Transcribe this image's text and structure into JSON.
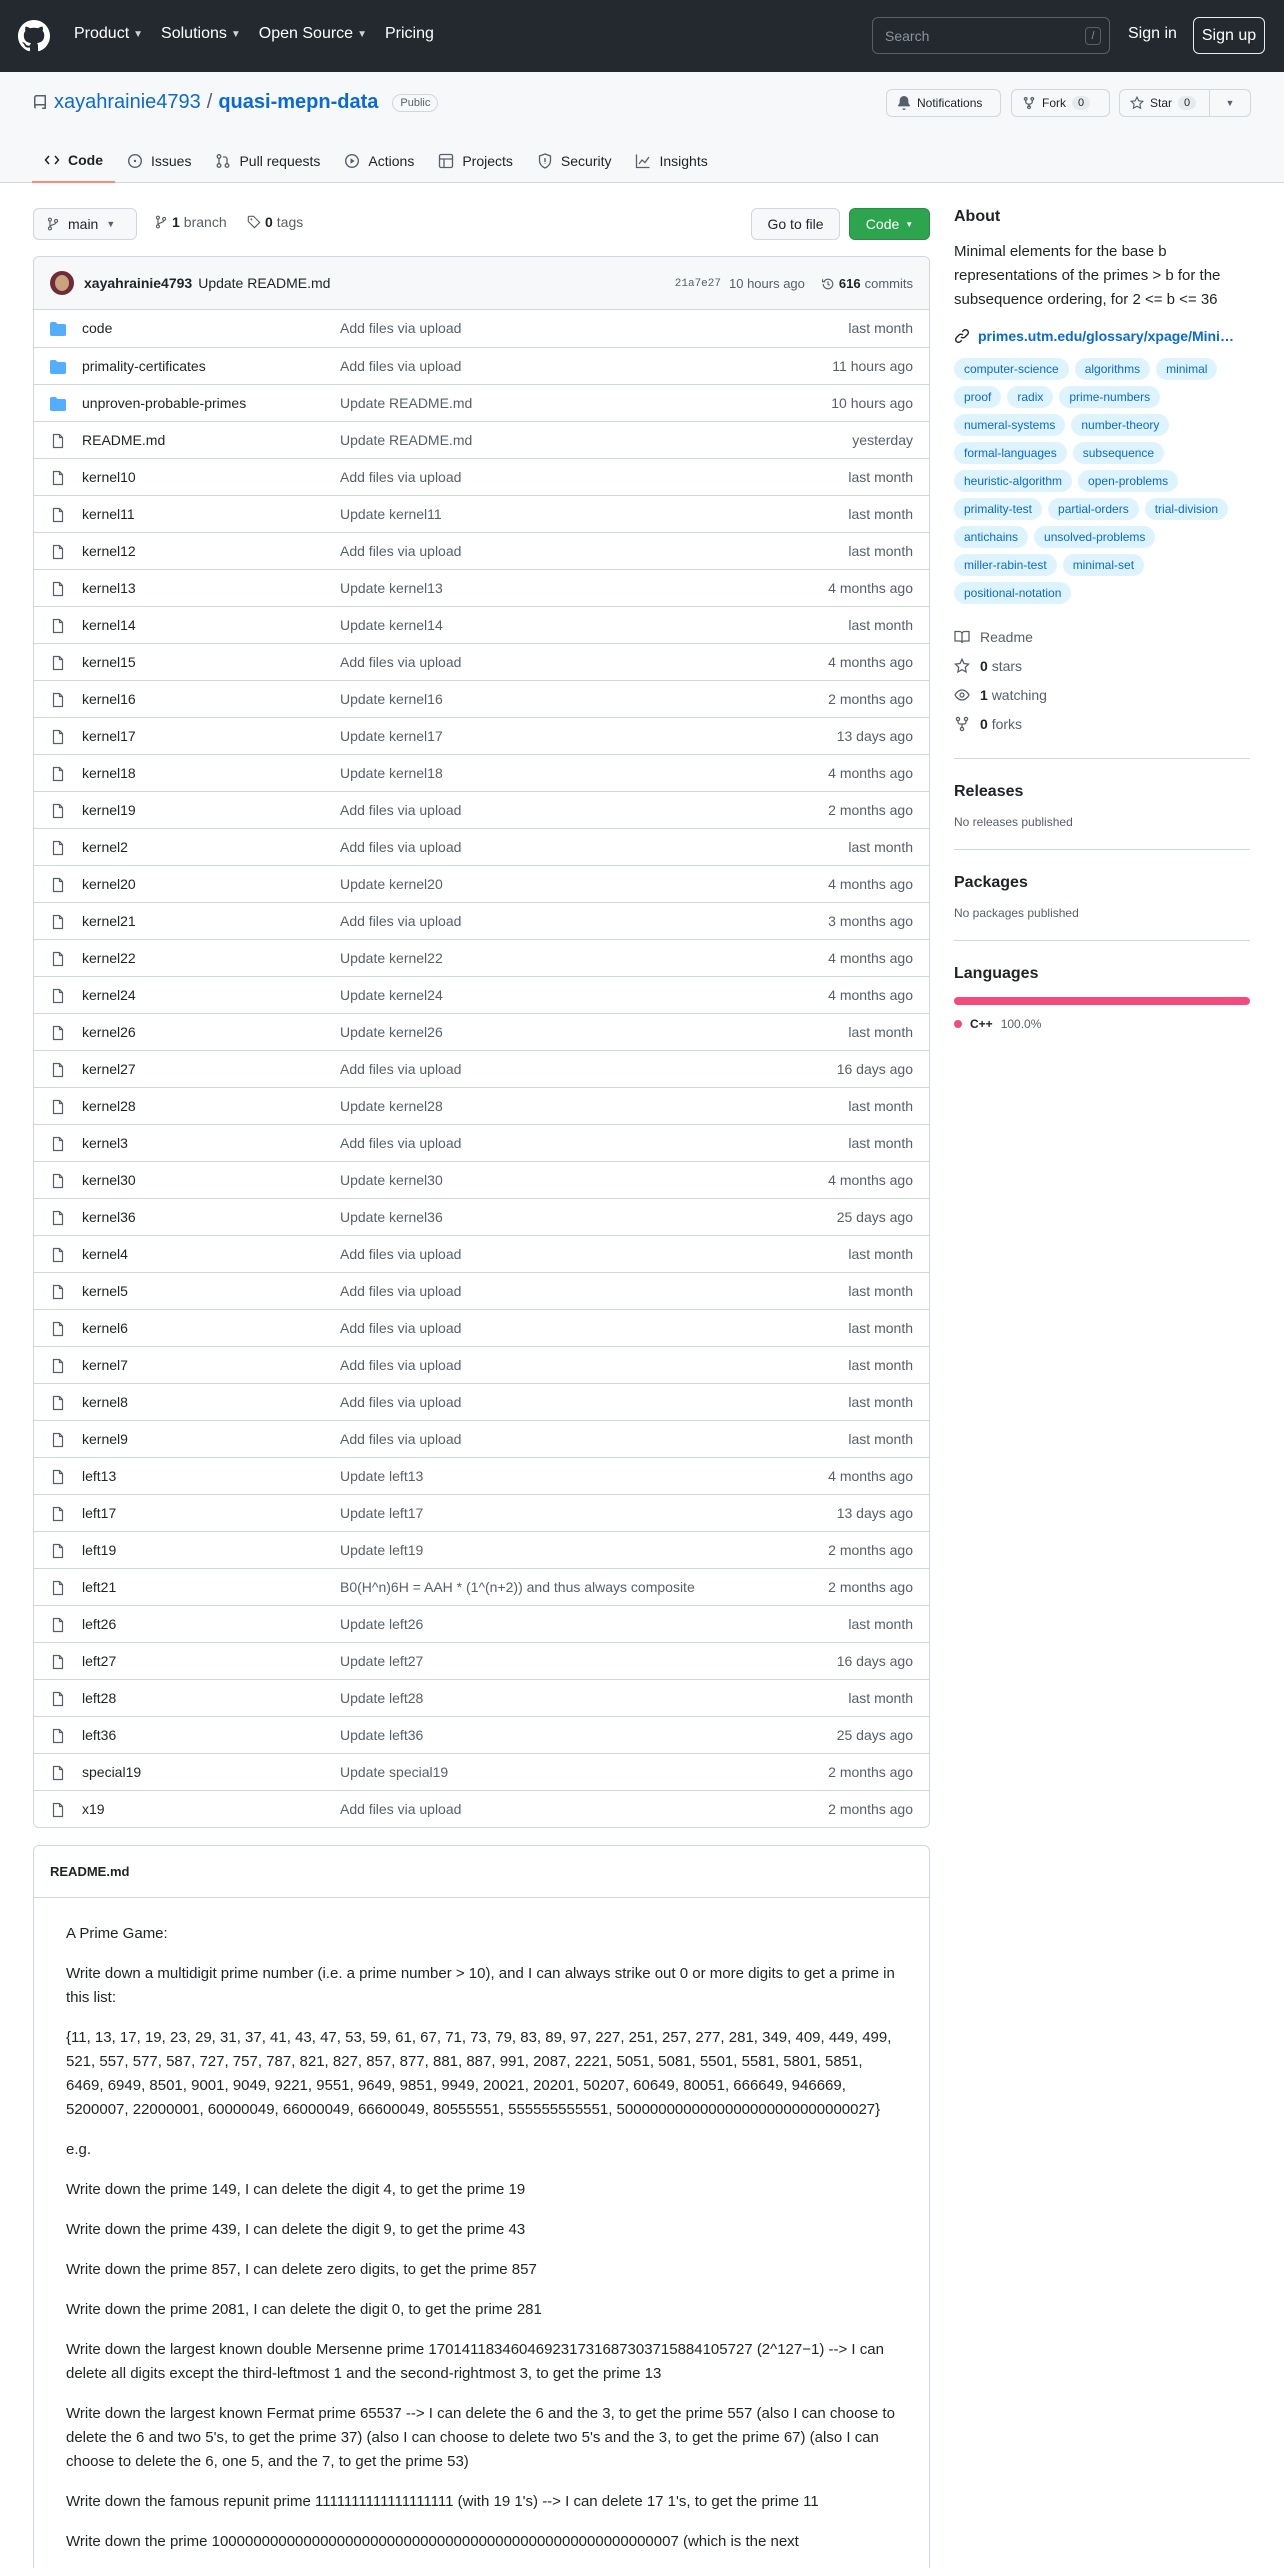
{
  "header": {
    "nav": [
      "Product",
      "Solutions",
      "Open Source",
      "Pricing"
    ],
    "search_placeholder": "Search",
    "search_shortcut": "/",
    "signin": "Sign in",
    "signup": "Sign up"
  },
  "repo": {
    "owner": "xayahrainie4793",
    "separator": "/",
    "name": "quasi-mepn-data",
    "visibility": "Public",
    "notifications": "Notifications",
    "fork_label": "Fork",
    "fork_count": "0",
    "star_label": "Star",
    "star_count": "0"
  },
  "tabs": [
    "Code",
    "Issues",
    "Pull requests",
    "Actions",
    "Projects",
    "Security",
    "Insights"
  ],
  "branchbar": {
    "branch": "main",
    "branches_count": "1",
    "branches_label": "branch",
    "tags_count": "0",
    "tags_label": "tags",
    "goto_file": "Go to file",
    "code_button": "Code"
  },
  "latest_commit": {
    "author": "xayahrainie4793",
    "message": "Update README.md",
    "sha": "21a7e27",
    "time": "10 hours ago",
    "commits_count": "616",
    "commits_label": "commits"
  },
  "files": [
    {
      "name": "code",
      "type": "dir",
      "msg": "Add files via upload",
      "age": "last month"
    },
    {
      "name": "primality-certificates",
      "type": "dir",
      "msg": "Add files via upload",
      "age": "11 hours ago"
    },
    {
      "name": "unproven-probable-primes",
      "type": "dir",
      "msg": "Update README.md",
      "age": "10 hours ago"
    },
    {
      "name": "README.md",
      "type": "file",
      "msg": "Update README.md",
      "age": "yesterday"
    },
    {
      "name": "kernel10",
      "type": "file",
      "msg": "Add files via upload",
      "age": "last month"
    },
    {
      "name": "kernel11",
      "type": "file",
      "msg": "Update kernel11",
      "age": "last month"
    },
    {
      "name": "kernel12",
      "type": "file",
      "msg": "Add files via upload",
      "age": "last month"
    },
    {
      "name": "kernel13",
      "type": "file",
      "msg": "Update kernel13",
      "age": "4 months ago"
    },
    {
      "name": "kernel14",
      "type": "file",
      "msg": "Update kernel14",
      "age": "last month"
    },
    {
      "name": "kernel15",
      "type": "file",
      "msg": "Add files via upload",
      "age": "4 months ago"
    },
    {
      "name": "kernel16",
      "type": "file",
      "msg": "Update kernel16",
      "age": "2 months ago"
    },
    {
      "name": "kernel17",
      "type": "file",
      "msg": "Update kernel17",
      "age": "13 days ago"
    },
    {
      "name": "kernel18",
      "type": "file",
      "msg": "Update kernel18",
      "age": "4 months ago"
    },
    {
      "name": "kernel19",
      "type": "file",
      "msg": "Add files via upload",
      "age": "2 months ago"
    },
    {
      "name": "kernel2",
      "type": "file",
      "msg": "Add files via upload",
      "age": "last month"
    },
    {
      "name": "kernel20",
      "type": "file",
      "msg": "Update kernel20",
      "age": "4 months ago"
    },
    {
      "name": "kernel21",
      "type": "file",
      "msg": "Add files via upload",
      "age": "3 months ago"
    },
    {
      "name": "kernel22",
      "type": "file",
      "msg": "Update kernel22",
      "age": "4 months ago"
    },
    {
      "name": "kernel24",
      "type": "file",
      "msg": "Update kernel24",
      "age": "4 months ago"
    },
    {
      "name": "kernel26",
      "type": "file",
      "msg": "Update kernel26",
      "age": "last month"
    },
    {
      "name": "kernel27",
      "type": "file",
      "msg": "Add files via upload",
      "age": "16 days ago"
    },
    {
      "name": "kernel28",
      "type": "file",
      "msg": "Update kernel28",
      "age": "last month"
    },
    {
      "name": "kernel3",
      "type": "file",
      "msg": "Add files via upload",
      "age": "last month"
    },
    {
      "name": "kernel30",
      "type": "file",
      "msg": "Update kernel30",
      "age": "4 months ago"
    },
    {
      "name": "kernel36",
      "type": "file",
      "msg": "Update kernel36",
      "age": "25 days ago"
    },
    {
      "name": "kernel4",
      "type": "file",
      "msg": "Add files via upload",
      "age": "last month"
    },
    {
      "name": "kernel5",
      "type": "file",
      "msg": "Add files via upload",
      "age": "last month"
    },
    {
      "name": "kernel6",
      "type": "file",
      "msg": "Add files via upload",
      "age": "last month"
    },
    {
      "name": "kernel7",
      "type": "file",
      "msg": "Add files via upload",
      "age": "last month"
    },
    {
      "name": "kernel8",
      "type": "file",
      "msg": "Add files via upload",
      "age": "last month"
    },
    {
      "name": "kernel9",
      "type": "file",
      "msg": "Add files via upload",
      "age": "last month"
    },
    {
      "name": "left13",
      "type": "file",
      "msg": "Update left13",
      "age": "4 months ago"
    },
    {
      "name": "left17",
      "type": "file",
      "msg": "Update left17",
      "age": "13 days ago"
    },
    {
      "name": "left19",
      "type": "file",
      "msg": "Update left19",
      "age": "2 months ago"
    },
    {
      "name": "left21",
      "type": "file",
      "msg": "B0(H^n)6H = AAH * (1^(n+2)) and thus always composite",
      "age": "2 months ago"
    },
    {
      "name": "left26",
      "type": "file",
      "msg": "Update left26",
      "age": "last month"
    },
    {
      "name": "left27",
      "type": "file",
      "msg": "Update left27",
      "age": "16 days ago"
    },
    {
      "name": "left28",
      "type": "file",
      "msg": "Update left28",
      "age": "last month"
    },
    {
      "name": "left36",
      "type": "file",
      "msg": "Update left36",
      "age": "25 days ago"
    },
    {
      "name": "special19",
      "type": "file",
      "msg": "Update special19",
      "age": "2 months ago"
    },
    {
      "name": "x19",
      "type": "file",
      "msg": "Add files via upload",
      "age": "2 months ago"
    }
  ],
  "readme": {
    "title": "README.md",
    "paragraphs": [
      "A Prime Game:",
      "Write down a multidigit prime number (i.e. a prime number > 10), and I can always strike out 0 or more digits to get a prime in this list:",
      "{11, 13, 17, 19, 23, 29, 31, 37, 41, 43, 47, 53, 59, 61, 67, 71, 73, 79, 83, 89, 97, 227, 251, 257, 277, 281, 349, 409, 449, 499, 521, 557, 577, 587, 727, 757, 787, 821, 827, 857, 877, 881, 887, 991, 2087, 2221, 5051, 5081, 5501, 5581, 5801, 5851, 6469, 6949, 8501, 9001, 9049, 9221, 9551, 9649, 9851, 9949, 20021, 20201, 50207, 60649, 80051, 666649, 946669, 5200007, 22000001, 60000049, 66000049, 66600049, 80555551, 555555555551, 5000000000000000000000000000027}",
      "e.g.",
      "Write down the prime 149, I can delete the digit 4, to get the prime 19",
      "Write down the prime 439, I can delete the digit 9, to get the prime 43",
      "Write down the prime 857, I can delete zero digits, to get the prime 857",
      "Write down the prime 2081, I can delete the digit 0, to get the prime 281",
      "Write down the largest known double Mersenne prime 170141183460469231731687303715884105727 (2^127−1) --> I can delete all digits except the third-leftmost 1 and the second-rightmost 3, to get the prime 13",
      "Write down the largest known Fermat prime 65537 --> I can delete the 6 and the 3, to get the prime 557 (also I can choose to delete the 6 and two 5's, to get the prime 37) (also I can choose to delete two 5's and the 3, to get the prime 67) (also I can choose to delete the 6, one 5, and the 7, to get the prime 53)",
      "Write down the famous repunit prime 1111111111111111111 (with 19 1's) --> I can delete 17 1's, to get the prime 11",
      "Write down the prime 10000000000000000000000000000000000000000000000000000007 (which is the next"
    ]
  },
  "about": {
    "title": "About",
    "description": "Minimal elements for the base b representations of the primes > b for the subsequence ordering, for 2 <= b <= 36",
    "link": "primes.utm.edu/glossary/xpage/Mini…",
    "topics": [
      "computer-science",
      "algorithms",
      "minimal",
      "proof",
      "radix",
      "prime-numbers",
      "numeral-systems",
      "number-theory",
      "formal-languages",
      "subsequence",
      "heuristic-algorithm",
      "open-problems",
      "primality-test",
      "partial-orders",
      "trial-division",
      "antichains",
      "unsolved-problems",
      "miller-rabin-test",
      "minimal-set",
      "positional-notation"
    ],
    "readme_label": "Readme",
    "stars_count": "0",
    "stars_label": "stars",
    "watching_count": "1",
    "watching_label": "watching",
    "forks_count": "0",
    "forks_label": "forks"
  },
  "releases": {
    "title": "Releases",
    "text": "No releases published"
  },
  "packages": {
    "title": "Packages",
    "text": "No packages published"
  },
  "languages": {
    "title": "Languages",
    "name": "C++",
    "percent": "100.0%",
    "color": "#f34b7d"
  }
}
